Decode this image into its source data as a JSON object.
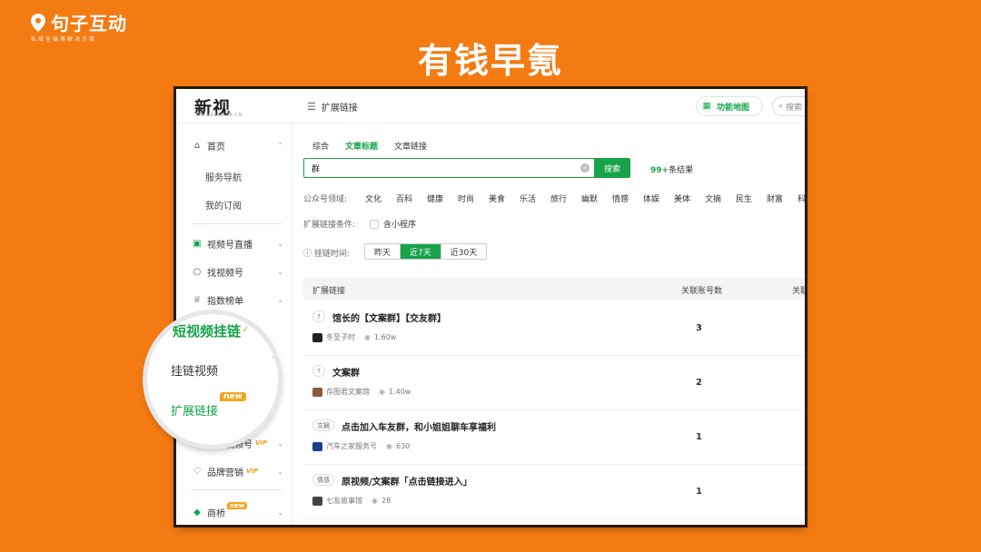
{
  "slide": {
    "brand_name": "句子互动",
    "brand_tagline": "私域全链路解决方案",
    "title": "有钱早氪"
  },
  "app": {
    "logo": "新视",
    "logo_sub": "XIN.NEWRANK.CN",
    "breadcrumb": "扩展链接",
    "function_map": "功能地图",
    "search_placeholder": "搜索"
  },
  "sidebar": {
    "home": "首页",
    "service_nav": "服务导航",
    "my_subs": "我的订阅",
    "live": "视频号直播",
    "find_channel": "找视频号",
    "rank": "指数榜单",
    "short_video": "短视频挂链",
    "mount_video": "挂链视频",
    "ext_link": "扩展链接",
    "promote": "推广视频号",
    "brand_marketing": "品牌营销",
    "bridge": "商桥",
    "vip_label": "VIP",
    "new_label": "new"
  },
  "main": {
    "tabs": [
      "综合",
      "文章标题",
      "文章链接"
    ],
    "active_tab": 1,
    "search_value": "群",
    "search_button": "搜索",
    "result_count": "99+",
    "result_suffix": "条结果",
    "domain_label": "公众号领域:",
    "categories": [
      "文化",
      "百科",
      "健康",
      "时尚",
      "美食",
      "乐活",
      "旅行",
      "幽默",
      "情感",
      "体娱",
      "美体",
      "文摘",
      "民生",
      "财富",
      "科"
    ],
    "condition_label": "扩展链接条件:",
    "mini_program": "含小程序",
    "time_label": "挂链时间:",
    "time_options": [
      "昨天",
      "近7天",
      "近30天"
    ],
    "active_time": 1,
    "col_link": "扩展链接",
    "col_accounts": "关联账号数",
    "col_extra": "关联"
  },
  "rows": [
    {
      "tag": "?",
      "title": "馆长的【文案群】【交友群】",
      "account": "冬至子时",
      "views": "1.60w",
      "count": "3"
    },
    {
      "tag": "?",
      "title": "文案群",
      "account": "存图君文案馆",
      "views": "1.40w",
      "count": "2"
    },
    {
      "tag": "文摘",
      "title": "点击加入车友群，和小姐姐聊车享福利",
      "account": "汽车之家服务号",
      "views": "630",
      "count": "1"
    },
    {
      "tag": "情感",
      "title": "原视频/文案群「点击链接进入」",
      "account": "七友故事馆",
      "views": "28",
      "count": "1"
    }
  ],
  "colors": {
    "accent": "#17a34a",
    "background": "#f47b12",
    "badge": "#f2a421"
  }
}
